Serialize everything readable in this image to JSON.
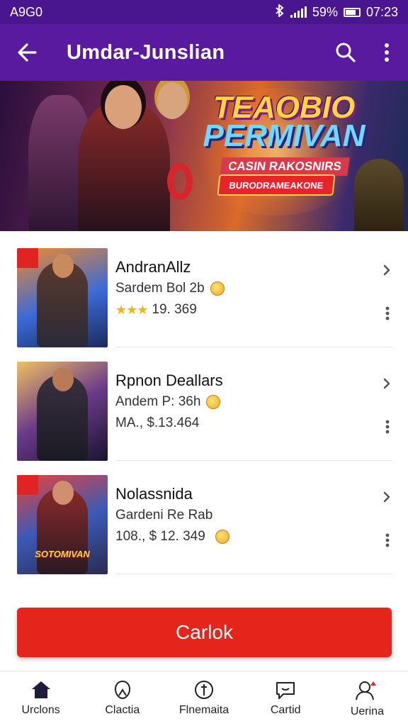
{
  "status_bar": {
    "left_text": "A9G0",
    "battery_text": "59%",
    "time": "07:23"
  },
  "app_bar": {
    "title": "Umdar-Junslian"
  },
  "banner": {
    "title_line1": "TEAOBIO",
    "title_line2": "PERMIVAN",
    "subtitle": "CASIN RAKOSNIRS",
    "pill_text": "BURODRAMEAKONE"
  },
  "list": [
    {
      "title": "AndranAllz",
      "subtitle": "Sardem Bol 2b",
      "meta": "19. 369",
      "stars": "★★★"
    },
    {
      "title": "Rpnon Deallars",
      "subtitle": "Andem P: 36h",
      "meta": "MA., $.13.464"
    },
    {
      "title": "Nolassnida",
      "subtitle": "Gardeni Re Rab",
      "meta": "108., $ 12. 349",
      "thumb_text": "SOTOMIVAN"
    }
  ],
  "cta": {
    "label": "Carlok"
  },
  "bottom_nav": [
    {
      "label": "Urclons",
      "icon": "home-icon"
    },
    {
      "label": "Clactia",
      "icon": "bookmark-icon"
    },
    {
      "label": "Flnemaita",
      "icon": "compass-icon"
    },
    {
      "label": "Cartid",
      "icon": "chat-icon"
    },
    {
      "label": "Uerina",
      "icon": "profile-icon"
    }
  ],
  "colors": {
    "app_bar": "#5a1aa0",
    "status_bar": "#4a168f",
    "cta": "#e5241b",
    "stars": "#f4b400"
  }
}
